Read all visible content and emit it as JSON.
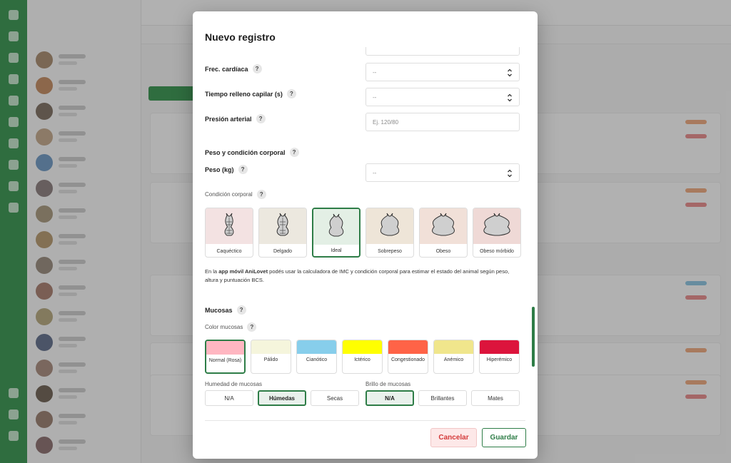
{
  "modal": {
    "title": "Nuevo registro",
    "fields": {
      "frec_cardiaca": {
        "label": "Frec. cardíaca",
        "value": "--"
      },
      "tiempo_relleno": {
        "label": "Tiempo relleno capilar (s)",
        "value": "--"
      },
      "presion": {
        "label": "Presión arterial",
        "placeholder": "Ej. 120/80"
      }
    },
    "peso_section": {
      "title": "Peso y condición corporal",
      "peso_label": "Peso (kg)",
      "peso_value": "--",
      "condicion_label": "Condición corporal",
      "options": [
        {
          "name": "Caquéctico",
          "bg": "#f3e2e2",
          "selected": false
        },
        {
          "name": "Delgado",
          "bg": "#ece8df",
          "selected": false
        },
        {
          "name": "Ideal",
          "bg": "#e3efe5",
          "selected": true
        },
        {
          "name": "Sobrepeso",
          "bg": "#eee5d8",
          "selected": false
        },
        {
          "name": "Obeso",
          "bg": "#f1e0d8",
          "selected": false
        },
        {
          "name": "Obeso mórbido",
          "bg": "#efd9d6",
          "selected": false
        }
      ]
    },
    "note": {
      "prefix": "En la ",
      "app": "app móvil AniLovet",
      "suffix": " podés usar la calculadora de IMC y condición corporal para estimar el estado del animal según peso, altura y puntuación BCS."
    },
    "mucosas": {
      "title": "Mucosas",
      "color_label": "Color mucosas",
      "colors": [
        {
          "name": "Normal (Rosa)",
          "color": "#ffb6c1",
          "selected": true
        },
        {
          "name": "Pálido",
          "color": "#f5f5dc",
          "selected": false
        },
        {
          "name": "Cianótico",
          "color": "#87ceeb",
          "selected": false
        },
        {
          "name": "Ictérico",
          "color": "#ffff00",
          "selected": false
        },
        {
          "name": "Congestionado",
          "color": "#ff6347",
          "selected": false
        },
        {
          "name": "Anémico",
          "color": "#f0e68c",
          "selected": false
        },
        {
          "name": "Hiperémico",
          "color": "#dc143c",
          "selected": false
        }
      ],
      "humedad_label": "Humedad de mucosas",
      "humedad_options": [
        {
          "name": "N/A",
          "selected": false
        },
        {
          "name": "Húmedas",
          "selected": true
        },
        {
          "name": "Secas",
          "selected": false
        }
      ],
      "brillo_label": "Brillo de mucosas",
      "brillo_options": [
        {
          "name": "N/A",
          "selected": true
        },
        {
          "name": "Brillantes",
          "selected": false
        },
        {
          "name": "Mates",
          "selected": false
        }
      ]
    },
    "buttons": {
      "cancel": "Cancelar",
      "save": "Guardar"
    }
  }
}
